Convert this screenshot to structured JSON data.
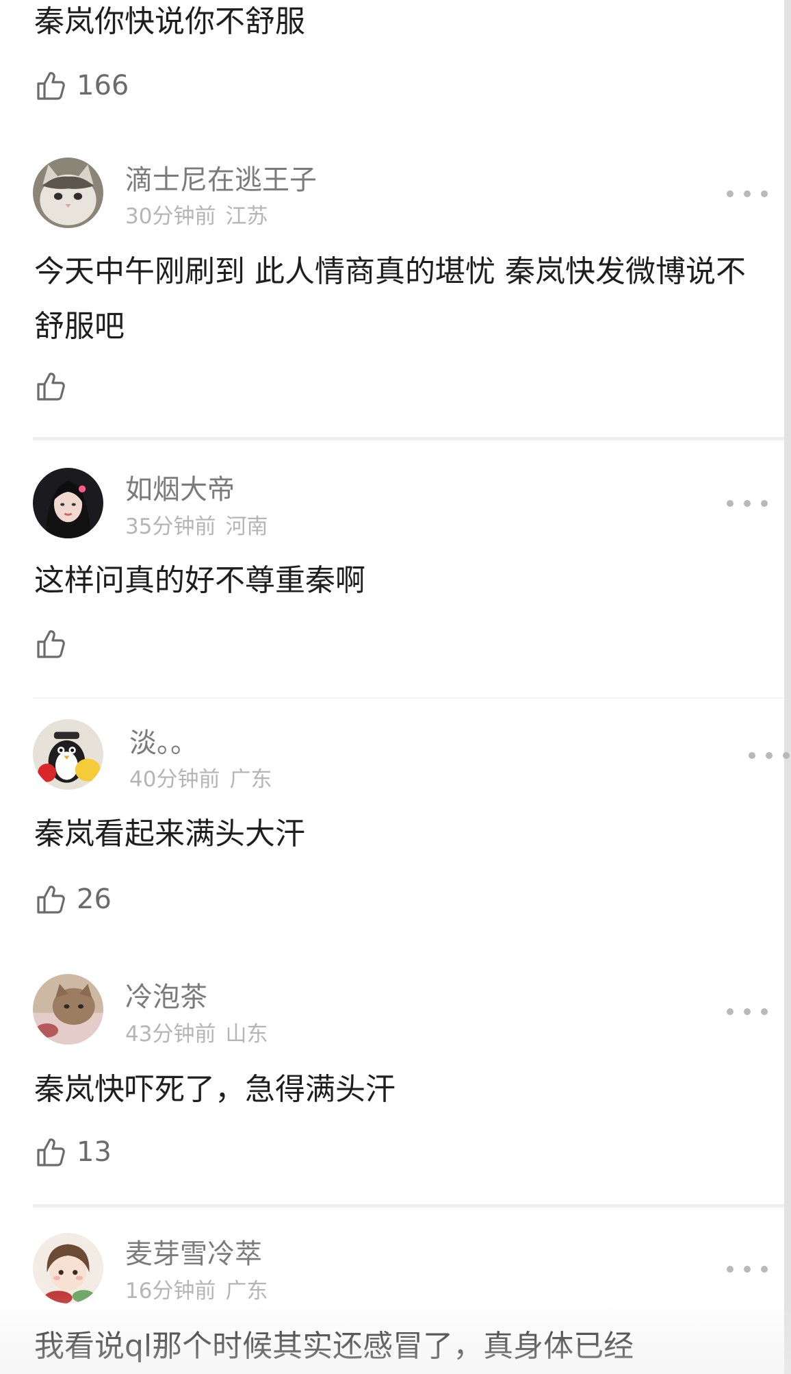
{
  "comments": [
    {
      "text": "秦岚你快说你不舒服",
      "likes": "166"
    },
    {
      "username": "滴士尼在逃王子",
      "time": "30分钟前",
      "location": "江苏",
      "avatar": "cat-photo-avatar",
      "text": "今天中午刚刷到 此人情商真的堪忧 秦岚快发微博说不舒服吧",
      "likes": ""
    },
    {
      "username": "如烟大帝",
      "time": "35分钟前",
      "location": "河南",
      "avatar": "woman-portrait-avatar",
      "text": "这样问真的好不尊重秦啊",
      "likes": ""
    },
    {
      "username": "淡。。",
      "time": "40分钟前",
      "location": "广东",
      "avatar": "penguin-cartoon-avatar",
      "text": "秦岚看起来满头大汗",
      "likes": "26"
    },
    {
      "username": "冷泡茶",
      "time": "43分钟前",
      "location": "山东",
      "avatar": "cat-photo-avatar",
      "text": "秦岚快吓死了，急得满头汗",
      "likes": "13"
    },
    {
      "username": "麦芽雪冷萃",
      "time": "16分钟前",
      "location": "广东",
      "avatar": "anime-girl-avatar",
      "text": "我看说ql那个时候其实还感冒了，真身体已经",
      "likes": ""
    }
  ],
  "icons": {
    "like": "thumbs-up-outline-icon",
    "more": "more-dots-icon"
  },
  "colors": {
    "text": "#1e1e1e",
    "username": "#7b7b7b",
    "meta": "#b5b5b5",
    "icon": "#6b6b6b",
    "divider": "#efefef"
  }
}
